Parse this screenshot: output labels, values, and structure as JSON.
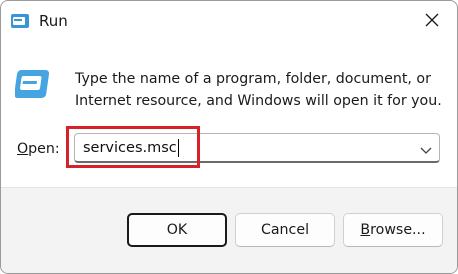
{
  "window": {
    "title": "Run",
    "icons": {
      "app": "run-icon",
      "close": "close-icon"
    }
  },
  "body": {
    "description": "Type the name of a program, folder, document, or Internet resource, and Windows will open it for you.",
    "open_label_mnemonic": "O",
    "open_label_rest": "pen:",
    "input_value": "services.msc",
    "dropdown_icon": "chevron-down-icon"
  },
  "buttons": {
    "ok": "OK",
    "cancel": "Cancel",
    "browse_mnemonic": "B",
    "browse_rest": "rowse..."
  },
  "colors": {
    "highlight": "#d6212a",
    "footer_bg": "#f3f3f3",
    "icon_blue": "#3a95d6"
  }
}
